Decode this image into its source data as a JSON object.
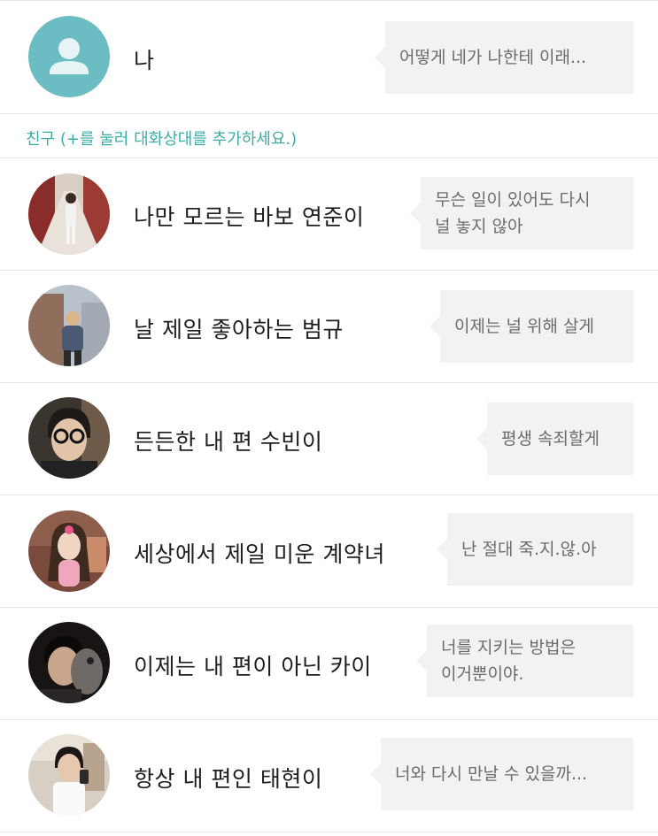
{
  "colors": {
    "accent": "#3aaea6",
    "default_avatar": "#6cbcc3",
    "bubble_bg": "#f2f2f2",
    "divider": "#e6e6e6"
  },
  "me": {
    "name": "나",
    "avatar_icon": "person-icon",
    "message": "어떻게 네가 나한테 이래..."
  },
  "friends_section": {
    "label": "친구 (+를 눌러 대화상대를 추가하세요.)"
  },
  "friends": [
    {
      "name": "나만 모르는 바보 연준이",
      "message": "무슨 일이 있어도 다시\n널 놓지 않아"
    },
    {
      "name": "날 제일 좋아하는 범규",
      "message": "이제는 널 위해 살게"
    },
    {
      "name": "든든한 내 편 수빈이",
      "message": "평생 속죄할게"
    },
    {
      "name": "세상에서 제일 미운 계약녀",
      "message": "난 절대 죽.지.않.아"
    },
    {
      "name": "이제는 내 편이 아닌 카이",
      "message": "너를 지키는 방법은\n이거뿐이야."
    },
    {
      "name": "항상 내 편인 태현이",
      "message": "너와 다시 만날 수 있을까..."
    }
  ]
}
